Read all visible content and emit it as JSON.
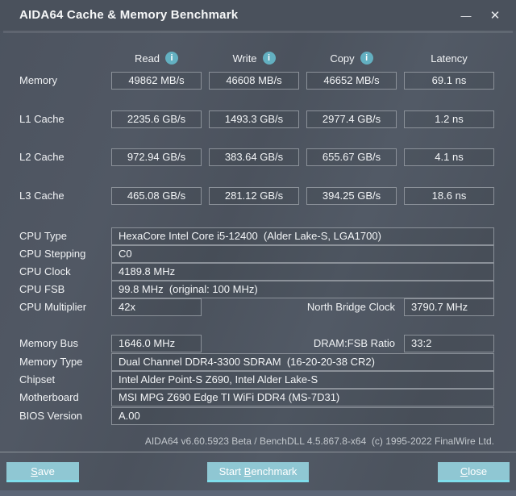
{
  "window": {
    "title": "AIDA64 Cache & Memory Benchmark",
    "minimize_glyph": "—",
    "close_glyph": "✕"
  },
  "benchmark": {
    "info_glyph": "i",
    "columns": [
      {
        "label": "Read",
        "has_info": true
      },
      {
        "label": "Write",
        "has_info": true
      },
      {
        "label": "Copy",
        "has_info": true
      },
      {
        "label": "Latency",
        "has_info": false
      }
    ],
    "rows": [
      {
        "label": "Memory",
        "read": "49862 MB/s",
        "write": "46608 MB/s",
        "copy": "46652 MB/s",
        "latency": "69.1 ns"
      },
      {
        "label": "L1 Cache",
        "read": "2235.6 GB/s",
        "write": "1493.3 GB/s",
        "copy": "2977.4 GB/s",
        "latency": "1.2 ns"
      },
      {
        "label": "L2 Cache",
        "read": "972.94 GB/s",
        "write": "383.64 GB/s",
        "copy": "655.67 GB/s",
        "latency": "4.1 ns"
      },
      {
        "label": "L3 Cache",
        "read": "465.08 GB/s",
        "write": "281.12 GB/s",
        "copy": "394.25 GB/s",
        "latency": "18.6 ns"
      }
    ]
  },
  "system": {
    "cpu_type": {
      "label": "CPU Type",
      "value": "HexaCore Intel Core i5-12400  (Alder Lake-S, LGA1700)"
    },
    "cpu_stepping": {
      "label": "CPU Stepping",
      "value": "C0"
    },
    "cpu_clock": {
      "label": "CPU Clock",
      "value": "4189.8 MHz"
    },
    "cpu_fsb": {
      "label": "CPU FSB",
      "value": "99.8 MHz  (original: 100 MHz)"
    },
    "cpu_multiplier": {
      "label": "CPU Multiplier",
      "value": "42x"
    },
    "north_bridge": {
      "label": "North Bridge Clock",
      "value": "3790.7 MHz"
    },
    "memory_bus": {
      "label": "Memory Bus",
      "value": "1646.0 MHz"
    },
    "dram_fsb": {
      "label": "DRAM:FSB Ratio",
      "value": "33:2"
    },
    "memory_type": {
      "label": "Memory Type",
      "value": "Dual Channel DDR4-3300 SDRAM  (16-20-20-38 CR2)"
    },
    "chipset": {
      "label": "Chipset",
      "value": "Intel Alder Point-S Z690, Intel Alder Lake-S"
    },
    "motherboard": {
      "label": "Motherboard",
      "value": "MSI MPG Z690 Edge TI WiFi DDR4 (MS-7D31)"
    },
    "bios_version": {
      "label": "BIOS Version",
      "value": "A.00"
    }
  },
  "footer": {
    "credit": "AIDA64 v6.60.5923 Beta / BenchDLL 4.5.867.8-x64  (c) 1995-2022 FinalWire Ltd."
  },
  "buttons": {
    "save": {
      "pre": "",
      "key": "S",
      "rest": "ave"
    },
    "start": {
      "pre": "Start ",
      "key": "B",
      "rest": "enchmark"
    },
    "close": {
      "pre": "",
      "key": "C",
      "rest": "lose"
    }
  },
  "colors": {
    "window_background": "#4d5460",
    "titlebar_background": "#4a515c",
    "box_border": "#8b9199",
    "button_accent": "#8fc7d3",
    "button_bottom_edge": "#7fdeeb",
    "info_icon": "#63b0c1",
    "footer_text": "#c3c8cd",
    "bottom_strip": "#5c6677"
  }
}
